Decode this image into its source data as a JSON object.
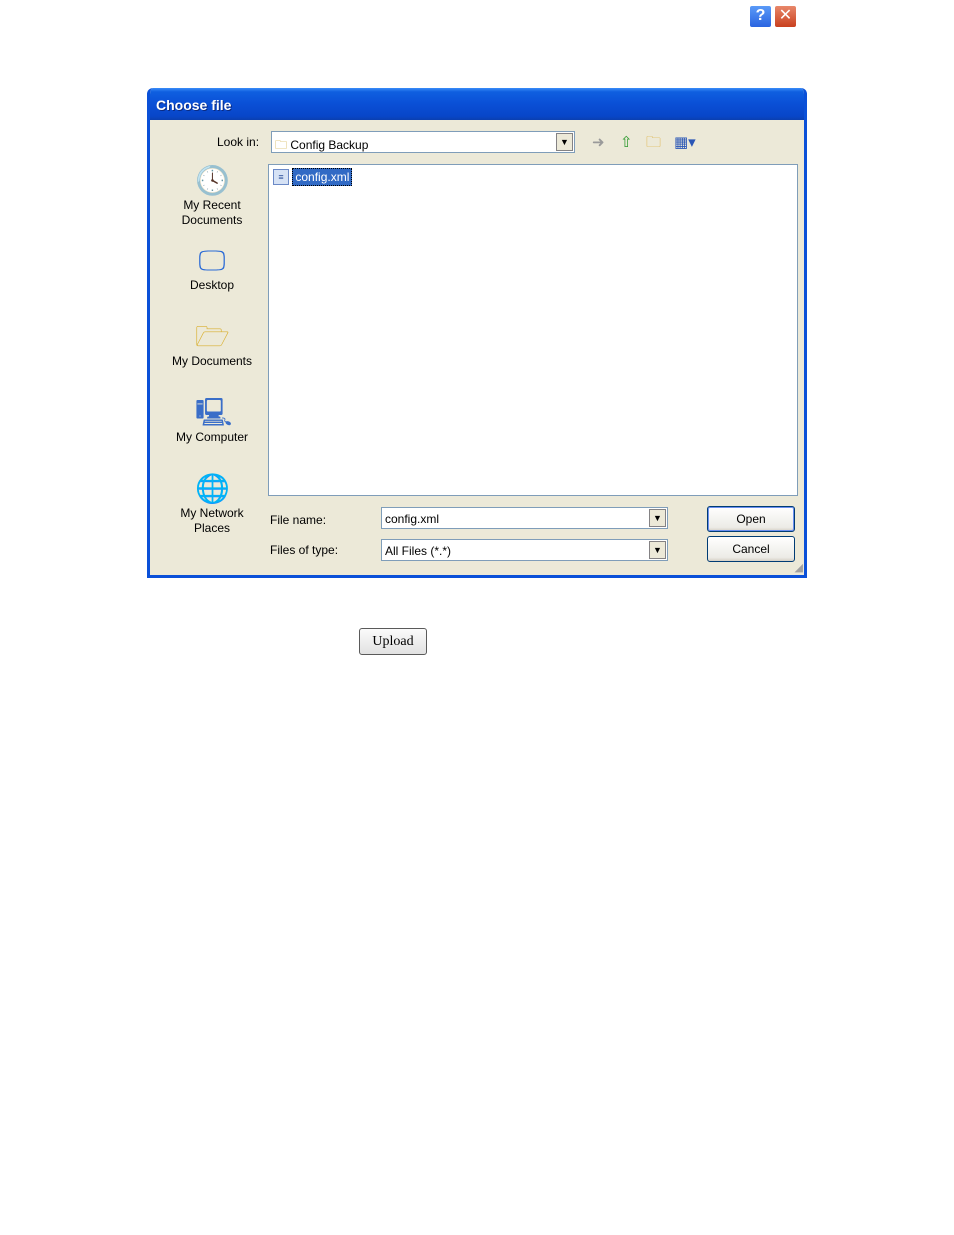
{
  "dialog": {
    "title": "Choose file",
    "help_glyph": "?",
    "close_glyph": "✕"
  },
  "lookin": {
    "label": "Look in:",
    "value": "Config Backup"
  },
  "toolbar": {
    "back_icon": "back-icon",
    "up_icon": "up-folder-icon",
    "new_folder_icon": "new-folder-icon",
    "views_icon": "views-menu-icon"
  },
  "places": [
    {
      "label": "My Recent Documents",
      "icon": "recent-documents-icon"
    },
    {
      "label": "Desktop",
      "icon": "desktop-icon"
    },
    {
      "label": "My Documents",
      "icon": "my-documents-icon"
    },
    {
      "label": "My Computer",
      "icon": "my-computer-icon"
    },
    {
      "label": "My Network Places",
      "icon": "network-places-icon"
    }
  ],
  "files": [
    {
      "name": "config.xml",
      "selected": true
    }
  ],
  "filename": {
    "label": "File name:",
    "value": "config.xml"
  },
  "filetype": {
    "label": "Files of type:",
    "value": "All Files (*.*)"
  },
  "buttons": {
    "open": "Open",
    "cancel": "Cancel"
  },
  "page": {
    "upload_label": "Upload"
  },
  "colors": {
    "titlebar": "#0a4fd6",
    "dialog_bg": "#ece9d8",
    "selection": "#316ac5"
  }
}
